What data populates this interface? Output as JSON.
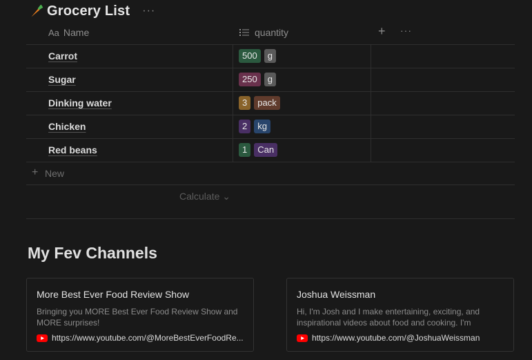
{
  "page": {
    "title": "Grocery List",
    "more_label": "···"
  },
  "table": {
    "col_name_prefix": "Aa",
    "col_name": "Name",
    "col_quantity": "quantity",
    "add_label": "+",
    "more_label": "···",
    "rows": [
      {
        "name": "Carrot",
        "amount": "500",
        "unit": "g",
        "amount_color": "#2b593f",
        "unit_color": "#5a5a5a"
      },
      {
        "name": "Sugar",
        "amount": "250",
        "unit": "g",
        "amount_color": "#69314c",
        "unit_color": "#5a5a5a"
      },
      {
        "name": "Dinking water",
        "amount": "3",
        "unit": "pack",
        "amount_color": "#89632a",
        "unit_color": "#603b2c"
      },
      {
        "name": "Chicken",
        "amount": "2",
        "unit": "kg",
        "amount_color": "#492f64",
        "unit_color": "#28456c"
      },
      {
        "name": "Red beans",
        "amount": "1",
        "unit": "Can",
        "amount_color": "#2b593f",
        "unit_color": "#492f64"
      }
    ],
    "new_plus": "+",
    "new_label": "New",
    "calculate_label": "Calculate ⌄"
  },
  "channels": {
    "title": "My Fev Channels",
    "cards": [
      {
        "title": "More Best Ever Food Review Show",
        "description": "Bringing you MORE Best Ever Food Review Show and MORE surprises!",
        "url": "https://www.youtube.com/@MoreBestEverFoodRe...",
        "icon": "youtube-icon"
      },
      {
        "title": "Joshua Weissman",
        "description": "Hi, I'm Josh and I make entertaining, exciting, and inspirational videos about food and cooking. I'm",
        "url": "https://www.youtube.com/@JoshuaWeissman",
        "icon": "youtube-icon"
      }
    ]
  },
  "colors": {
    "background": "#191919",
    "youtube_red": "#ff0000"
  }
}
